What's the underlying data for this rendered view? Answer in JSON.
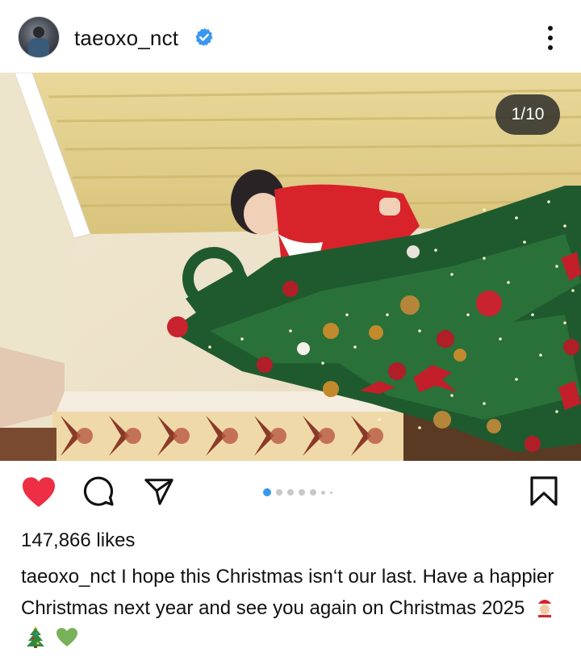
{
  "post": {
    "username": "taeoxo_nct",
    "verified": true,
    "image_counter": "1/10",
    "carousel": {
      "total_dots": 7,
      "active_index": 0
    }
  },
  "actions": {
    "like_icon": "heart-filled-icon",
    "comment_icon": "comment-icon",
    "share_icon": "paper-plane-icon",
    "save_icon": "bookmark-icon",
    "like_color": "#ED2E45",
    "active_dot_color": "#3897F0"
  },
  "likes_text": "147,866 likes",
  "caption": {
    "username": "taeoxo_nct",
    "text": "I hope this Christmas isn‘t our last. Have a happier Christmas next year and see you again on Christmas 2025",
    "emojis": [
      "santa-emoji",
      "christmas-tree-emoji",
      "green-heart-emoji"
    ]
  }
}
